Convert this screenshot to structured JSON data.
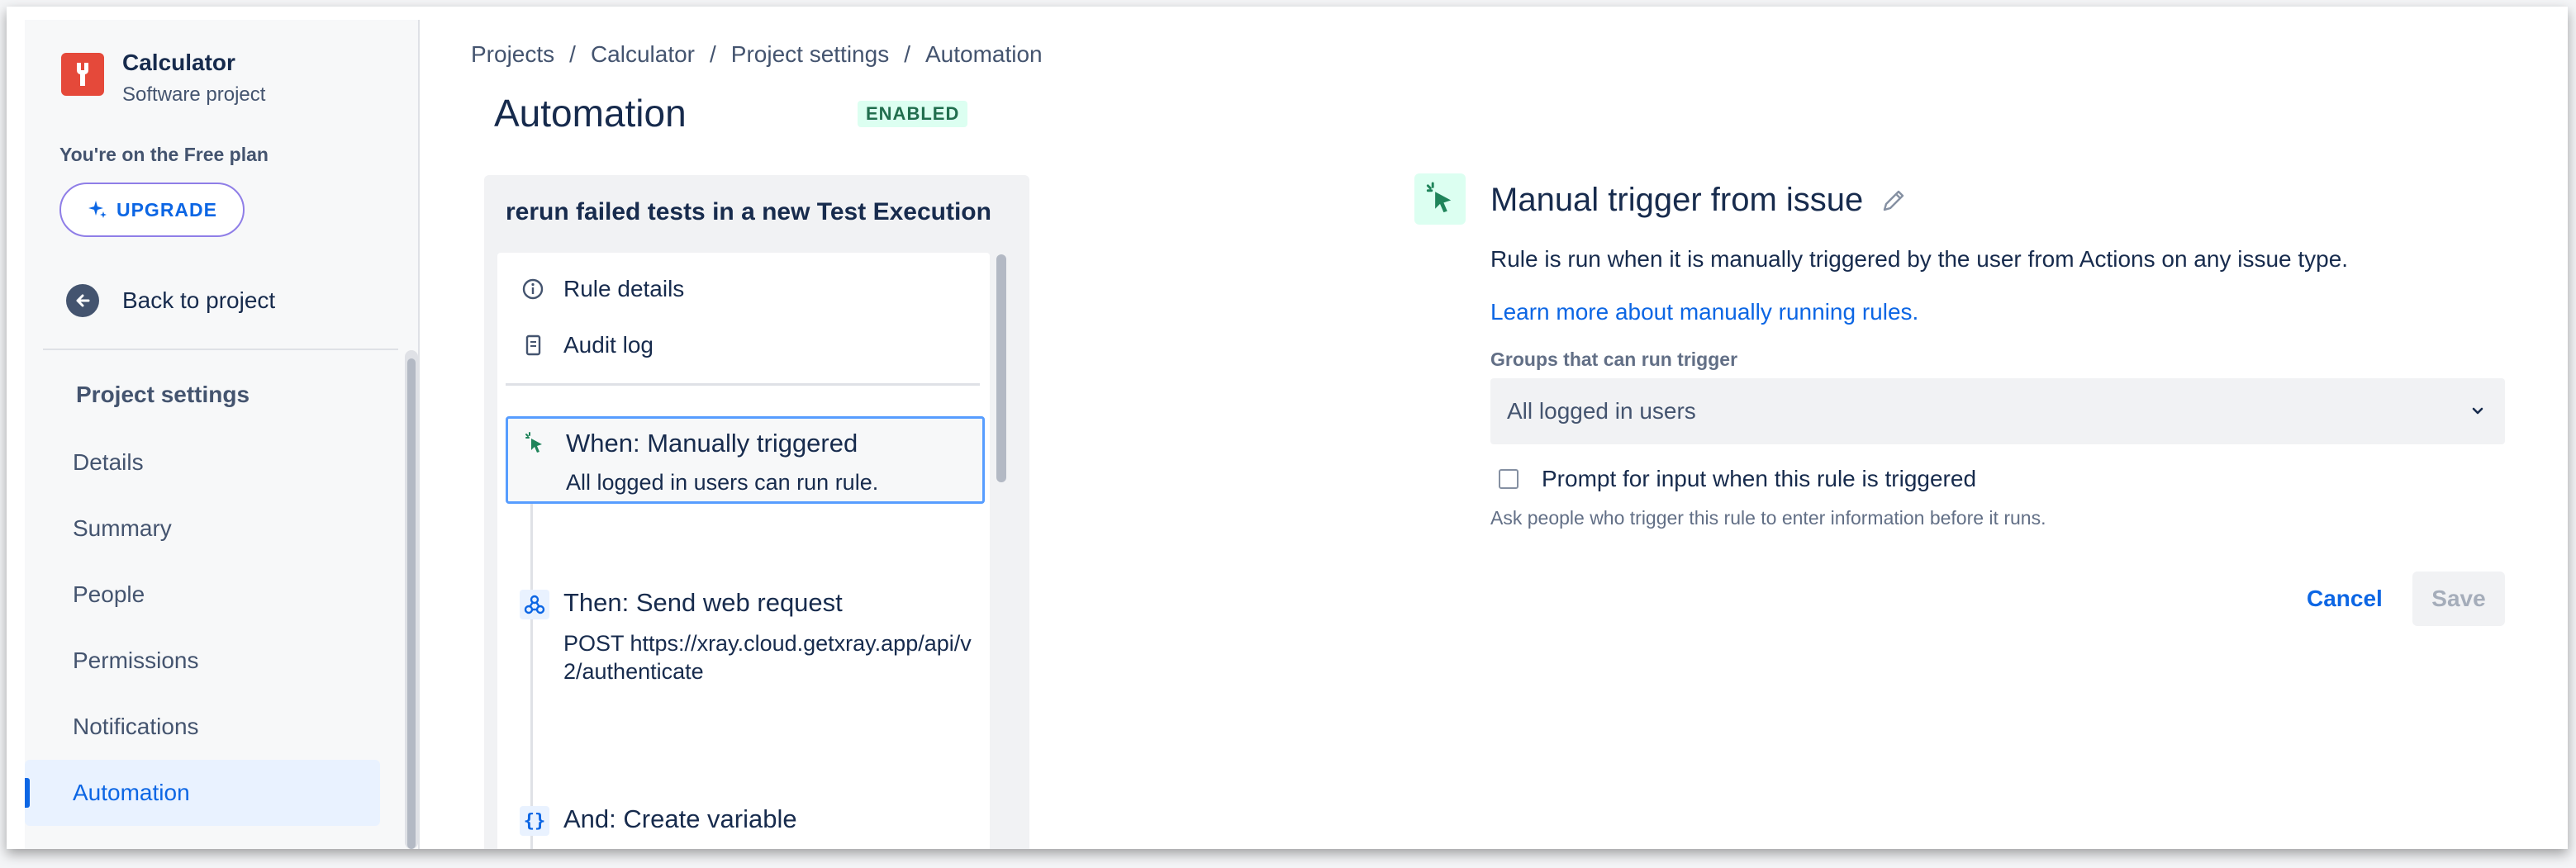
{
  "project": {
    "name": "Calculator",
    "type": "Software project"
  },
  "plan": {
    "text": "You're on the Free plan",
    "upgrade_label": "UPGRADE"
  },
  "back_label": "Back to project",
  "sidebar": {
    "section_title": "Project settings",
    "items": [
      {
        "label": "Details",
        "active": false
      },
      {
        "label": "Summary",
        "active": false
      },
      {
        "label": "People",
        "active": false
      },
      {
        "label": "Permissions",
        "active": false
      },
      {
        "label": "Notifications",
        "active": false
      },
      {
        "label": "Automation",
        "active": true
      }
    ]
  },
  "breadcrumbs": [
    "Projects",
    "Calculator",
    "Project settings",
    "Automation"
  ],
  "breadcrumb_sep": "/",
  "page": {
    "title": "Automation",
    "status": "ENABLED"
  },
  "rule": {
    "name": "rerun failed tests in a new Test Execution",
    "meta": [
      {
        "label": "Rule details",
        "icon": "info-icon"
      },
      {
        "label": "Audit log",
        "icon": "document-icon"
      }
    ],
    "steps": [
      {
        "title": "When: Manually triggered",
        "subtitle": "All logged in users can run rule.",
        "icon": "cursor-click-icon"
      },
      {
        "title": "Then: Send web request",
        "subtitle": "POST https://xray.cloud.getxray.app/api/v2/authenticate",
        "icon": "webhook-icon"
      },
      {
        "title": "And: Create variable",
        "subtitle": "",
        "icon": "braces-icon"
      }
    ]
  },
  "trigger": {
    "title": "Manual trigger from issue",
    "description": "Rule is run when it is manually triggered by the user from Actions on any issue type.",
    "learn_more": "Learn more about manually running rules.",
    "groups_label": "Groups that can run trigger",
    "groups_value": "All logged in users",
    "prompt_label": "Prompt for input when this rule is triggered",
    "prompt_checked": false,
    "prompt_help": "Ask people who trigger this rule to enter information before it runs.",
    "cancel_label": "Cancel",
    "save_label": "Save"
  },
  "colors": {
    "accent": "#0c66e4",
    "trigger_green": "#1f845a",
    "logo": "#e5493a"
  }
}
